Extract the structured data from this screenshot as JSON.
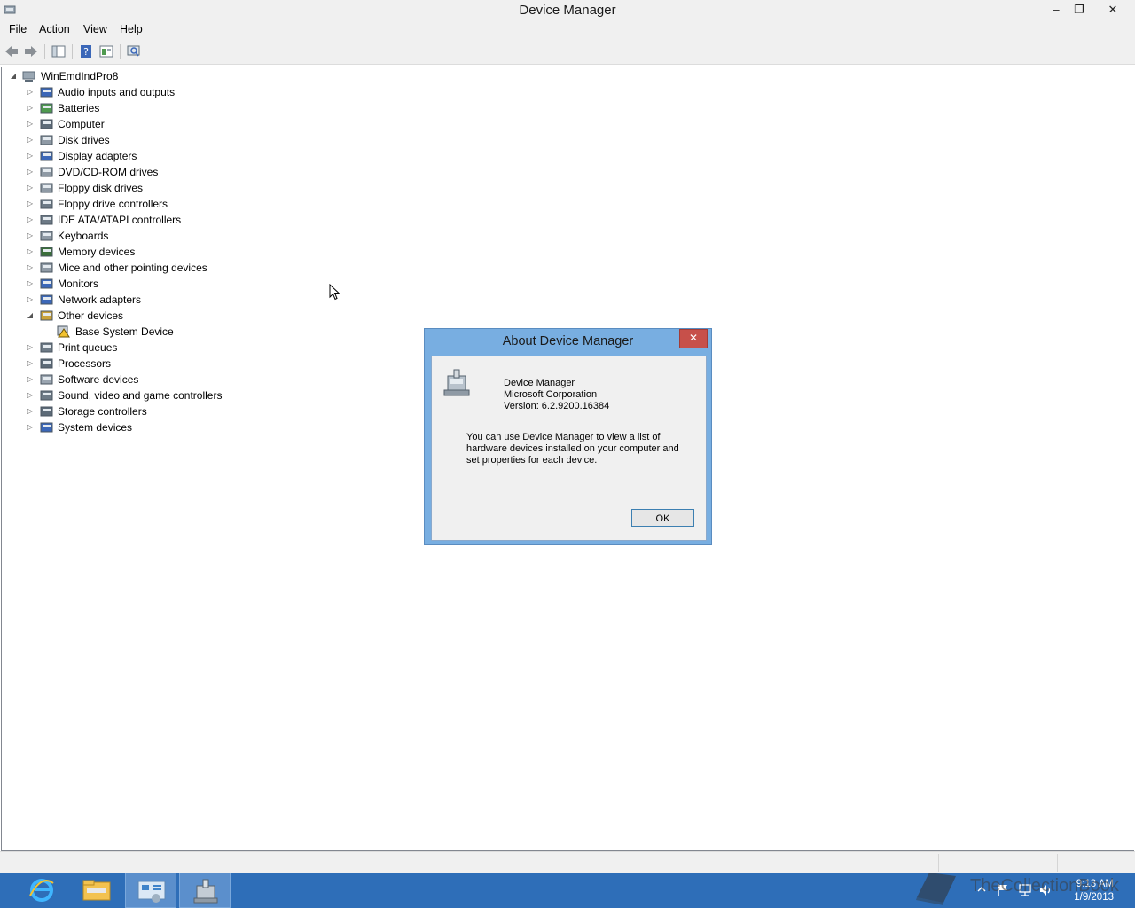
{
  "window": {
    "title": "Device Manager",
    "controls": {
      "minimize": "–",
      "restore": "❐",
      "close": "✕"
    }
  },
  "menu": [
    "File",
    "Action",
    "View",
    "Help"
  ],
  "toolbar": {
    "icons": [
      "back-arrow-icon",
      "forward-arrow-icon",
      "show-hide-console-tree-icon",
      "help-icon",
      "properties-icon",
      "scan-hardware-icon"
    ]
  },
  "tree": {
    "root": "WinEmdIndPro8",
    "categories": [
      "Audio inputs and outputs",
      "Batteries",
      "Computer",
      "Disk drives",
      "Display adapters",
      "DVD/CD-ROM drives",
      "Floppy disk drives",
      "Floppy drive controllers",
      "IDE ATA/ATAPI controllers",
      "Keyboards",
      "Memory devices",
      "Mice and other pointing devices",
      "Monitors",
      "Network adapters",
      "Other devices",
      "Print queues",
      "Processors",
      "Software devices",
      "Sound, video and game controllers",
      "Storage controllers",
      "System devices"
    ],
    "expanded": "Other devices",
    "child": "Base System Device"
  },
  "dialog": {
    "title": "About Device Manager",
    "close": "✕",
    "product": "Device Manager",
    "company": "Microsoft Corporation",
    "version": "Version: 6.2.9200.16384",
    "description_lines": [
      "You can use Device Manager to view a list of",
      "hardware devices installed on your computer and",
      "set properties for each device."
    ],
    "ok": "OK"
  },
  "taskbar": {
    "apps": [
      "internet-explorer-icon",
      "file-explorer-icon",
      "control-panel-icon",
      "device-manager-icon"
    ],
    "time": "9:13 AM",
    "date": "1/9/2013",
    "tray_icons": [
      "show-hidden-icons-icon",
      "action-center-flag-icon",
      "network-icon",
      "volume-icon"
    ]
  },
  "watermark": "TheCollectionBook",
  "colors": {
    "taskbar": "#2e6eb8",
    "dialog_frame": "#78aee1",
    "dialog_close": "#c7504a",
    "chrome": "#f0f0f0"
  }
}
